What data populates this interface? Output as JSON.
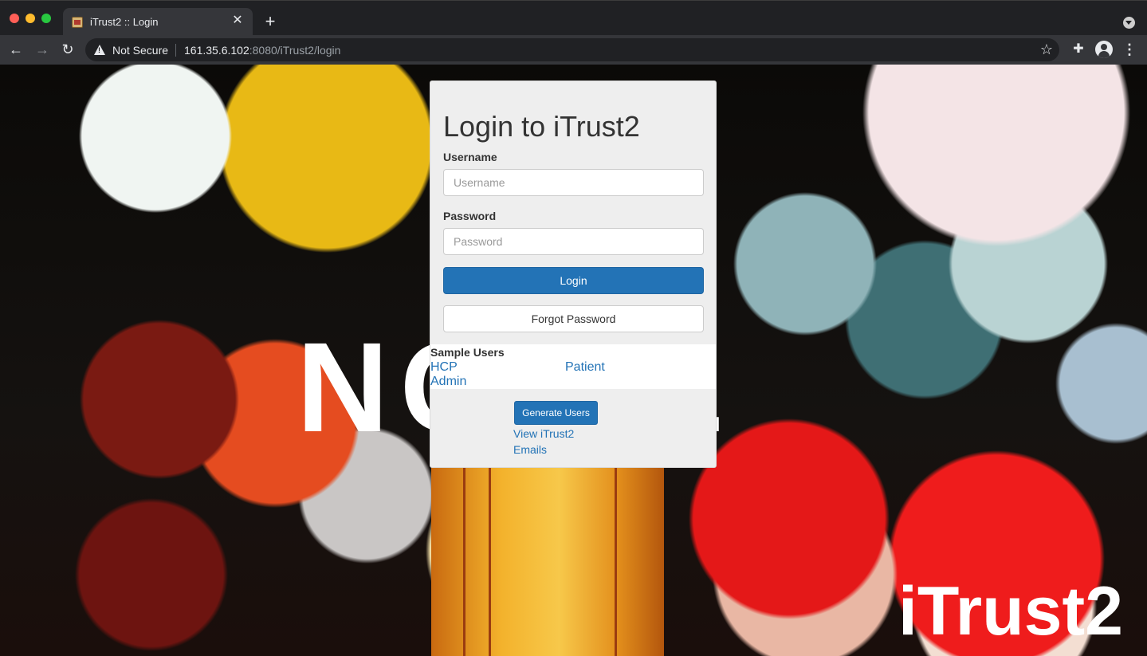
{
  "browser": {
    "tab_title": "iTrust2 :: Login",
    "security_label": "Not Secure",
    "url_host": "161.35.6.102",
    "url_path": ":8080/iTrust2/login"
  },
  "login": {
    "title": "Login to iTrust2",
    "username_label": "Username",
    "username_placeholder": "Username",
    "username_value": "",
    "password_label": "Password",
    "password_placeholder": "Password",
    "password_value": "",
    "login_button": "Login",
    "forgot_button": "Forgot Password"
  },
  "sample_users": {
    "title": "Sample Users",
    "links": [
      "HCP",
      "Patient",
      "Admin"
    ]
  },
  "tools": {
    "generate_button": "Generate Users",
    "emails_link": "View iTrust2 Emails"
  },
  "background": {
    "watermark_text": "NC        TE",
    "brand_text": "iTrust2"
  },
  "colors": {
    "primary": "#2373b6",
    "panel": "#eeeeee",
    "chrome": "#35363a"
  }
}
